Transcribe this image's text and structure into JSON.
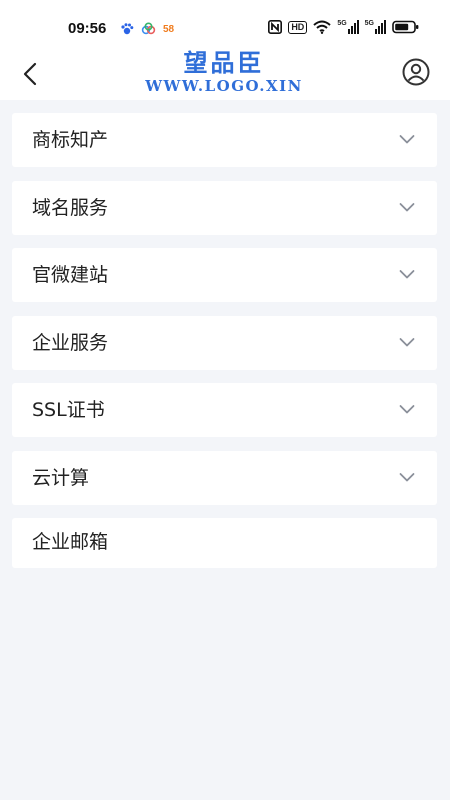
{
  "status_bar": {
    "time": "09:56",
    "app_icons": [
      "baidu-paw-icon",
      "baidu-cloud-icon",
      "58-app-icon"
    ],
    "icon_58_text": "58",
    "system_icons": [
      "nfc-icon",
      "hd-icon",
      "wifi-icon",
      "5g-signal-icon",
      "5g-signal-icon",
      "battery-icon"
    ],
    "hd_text": "HD",
    "signal_text": "5G"
  },
  "header": {
    "back_icon": "chevron-left-icon",
    "logo_title": "望品臣",
    "logo_url": "WWW.LOGO.XIN",
    "profile_icon": "user-circle-icon"
  },
  "menu": {
    "items": [
      {
        "label": "商标知产",
        "has_chevron": true
      },
      {
        "label": "域名服务",
        "has_chevron": true
      },
      {
        "label": "官微建站",
        "has_chevron": true
      },
      {
        "label": "企业服务",
        "has_chevron": true
      },
      {
        "label": "SSL证书",
        "has_chevron": true
      },
      {
        "label": "云计算",
        "has_chevron": true
      },
      {
        "label": "企业邮箱",
        "has_chevron": false
      }
    ]
  },
  "colors": {
    "accent": "#2f6ed8",
    "background": "#f3f5f9",
    "card": "#ffffff",
    "chevron": "#8a8f99"
  }
}
